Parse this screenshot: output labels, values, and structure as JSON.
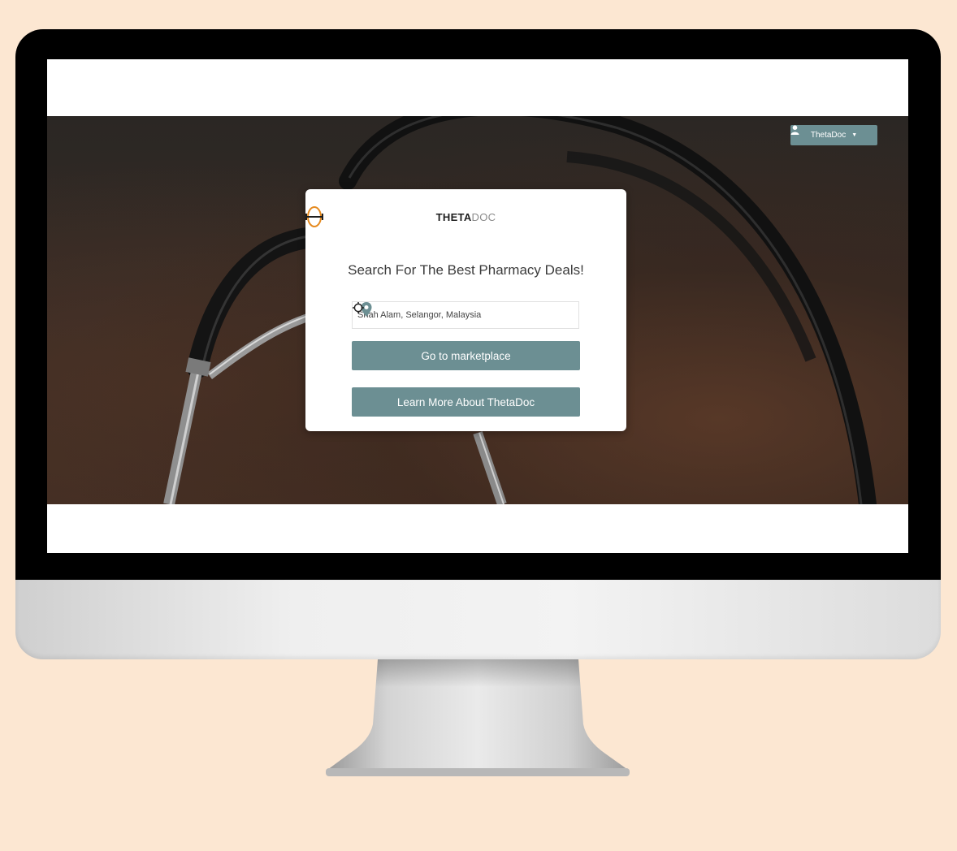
{
  "colors": {
    "page_background": "#fce7d2",
    "accent": "#6c8f93",
    "logo_theta": "#e58a1f"
  },
  "header": {
    "user_menu_label": "ThetaDoc",
    "user_icon": "user-icon",
    "caret_icon": "caret-down-icon"
  },
  "logo": {
    "left_text": "THETA",
    "right_text": "DOC"
  },
  "card": {
    "title": "Search For The Best Pharmacy Deals!",
    "location": {
      "value": "Shah Alam, Selangor, Malaysia",
      "pin_icon": "map-pin-icon",
      "locate_icon": "crosshair-icon"
    },
    "marketplace_button": "Go to marketplace",
    "learn_more_button": "Learn More About ThetaDoc"
  },
  "chat": {
    "icon": "chat-icon"
  }
}
